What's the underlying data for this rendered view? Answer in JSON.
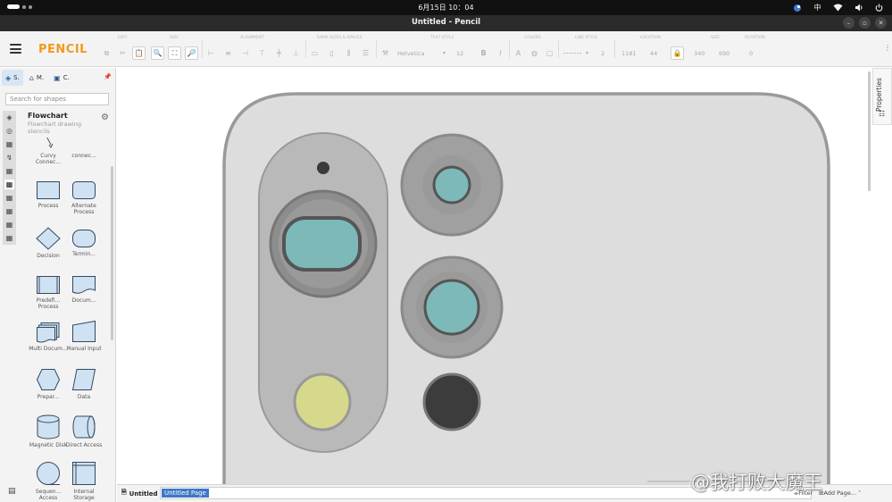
{
  "system_bar": {
    "clock": "6月15日 10：04",
    "input_method": "中"
  },
  "window": {
    "title": "Untitled - Pencil"
  },
  "app": {
    "logo": "PENCIL"
  },
  "toolbar": {
    "group_labels": [
      "EDIT",
      "SIZE",
      "ALIGNMENT",
      "SAME SIZES & SPACES",
      "TEXT STYLE",
      "COLORS",
      "LINE STYLE",
      "LOCATION",
      "SIZE",
      "ROTATION"
    ],
    "font_family": "Helvetica",
    "font_size": "12",
    "line_width": "2",
    "location_x": "1181",
    "location_y": "44",
    "size_w": "340",
    "size_h": "690",
    "rotation": "0"
  },
  "sidebar": {
    "tabs": [
      {
        "label": "S.",
        "icon": "layers-icon"
      },
      {
        "label": "M.",
        "icon": "shapes-icon"
      },
      {
        "label": "C.",
        "icon": "clipart-icon"
      }
    ],
    "search_placeholder": "Search for shapes",
    "collection": {
      "title": "Flowchart",
      "description": "Flowchart drawing stencils"
    },
    "shapes": [
      {
        "label": "Curvy Connec..."
      },
      {
        "label": "connec..."
      },
      {
        "label": "Process"
      },
      {
        "label": "Alternate Process"
      },
      {
        "label": "Decision"
      },
      {
        "label": "Termin..."
      },
      {
        "label": "Predefi... Process"
      },
      {
        "label": "Docum..."
      },
      {
        "label": "Multi Docum..."
      },
      {
        "label": "Manual Input"
      },
      {
        "label": "Prepar..."
      },
      {
        "label": "Data"
      },
      {
        "label": "Magnetic Disk"
      },
      {
        "label": "Direct Access"
      },
      {
        "label": "Sequen... Access"
      },
      {
        "label": "Internal Storage"
      }
    ]
  },
  "canvas": {
    "phone_body_color": "#dddddd",
    "lens_teal_color": "#7db9b8",
    "flash_color": "#d6d88c",
    "dark_sensor_color": "#3c3c3c"
  },
  "properties": {
    "label": "Properties"
  },
  "pagebar": {
    "tab_label": "Untitled",
    "page_name": "Untitled Page",
    "filter_label": "Filter",
    "add_page_label": "Add Page..."
  },
  "watermark": {
    "text": "@我打败大魔王"
  }
}
